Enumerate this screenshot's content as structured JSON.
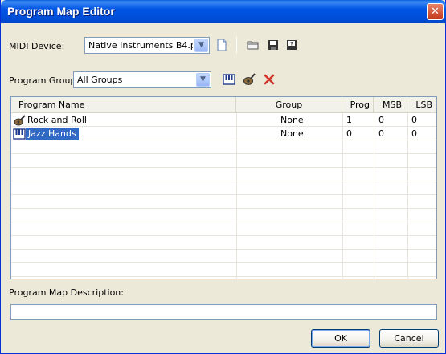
{
  "window": {
    "title": "Program Map Editor",
    "close_glyph": "✕"
  },
  "midi_device": {
    "label": "MIDI Device:",
    "selected": "Native Instruments B4.p",
    "toolbar_icons": [
      "new-file-icon",
      "open-folder-icon",
      "save-icon",
      "save-as-icon"
    ]
  },
  "program_group": {
    "label": "Program Group:",
    "selected": "All Groups",
    "toolbar_icons": [
      "keyboard-icon",
      "edit-instrument-icon",
      "delete-icon"
    ]
  },
  "table": {
    "columns": [
      "Program Name",
      "Group",
      "Prog",
      "MSB",
      "LSB"
    ],
    "rows": [
      {
        "name": "Rock and Roll",
        "icon": "guitar-icon",
        "group": "None",
        "prog": "1",
        "msb": "0",
        "lsb": "0",
        "selected": false
      },
      {
        "name": "Jazz Hands",
        "icon": "keyboard-icon",
        "group": "None",
        "prog": "0",
        "msb": "0",
        "lsb": "0",
        "selected": true
      }
    ]
  },
  "description": {
    "label": "Program Map Description:",
    "value": ""
  },
  "buttons": {
    "ok": "OK",
    "cancel": "Cancel"
  },
  "colors": {
    "title_bar": "#0054e3",
    "selection": "#316ac5",
    "window_bg": "#ece9d8",
    "delete_red": "#d0342c"
  }
}
